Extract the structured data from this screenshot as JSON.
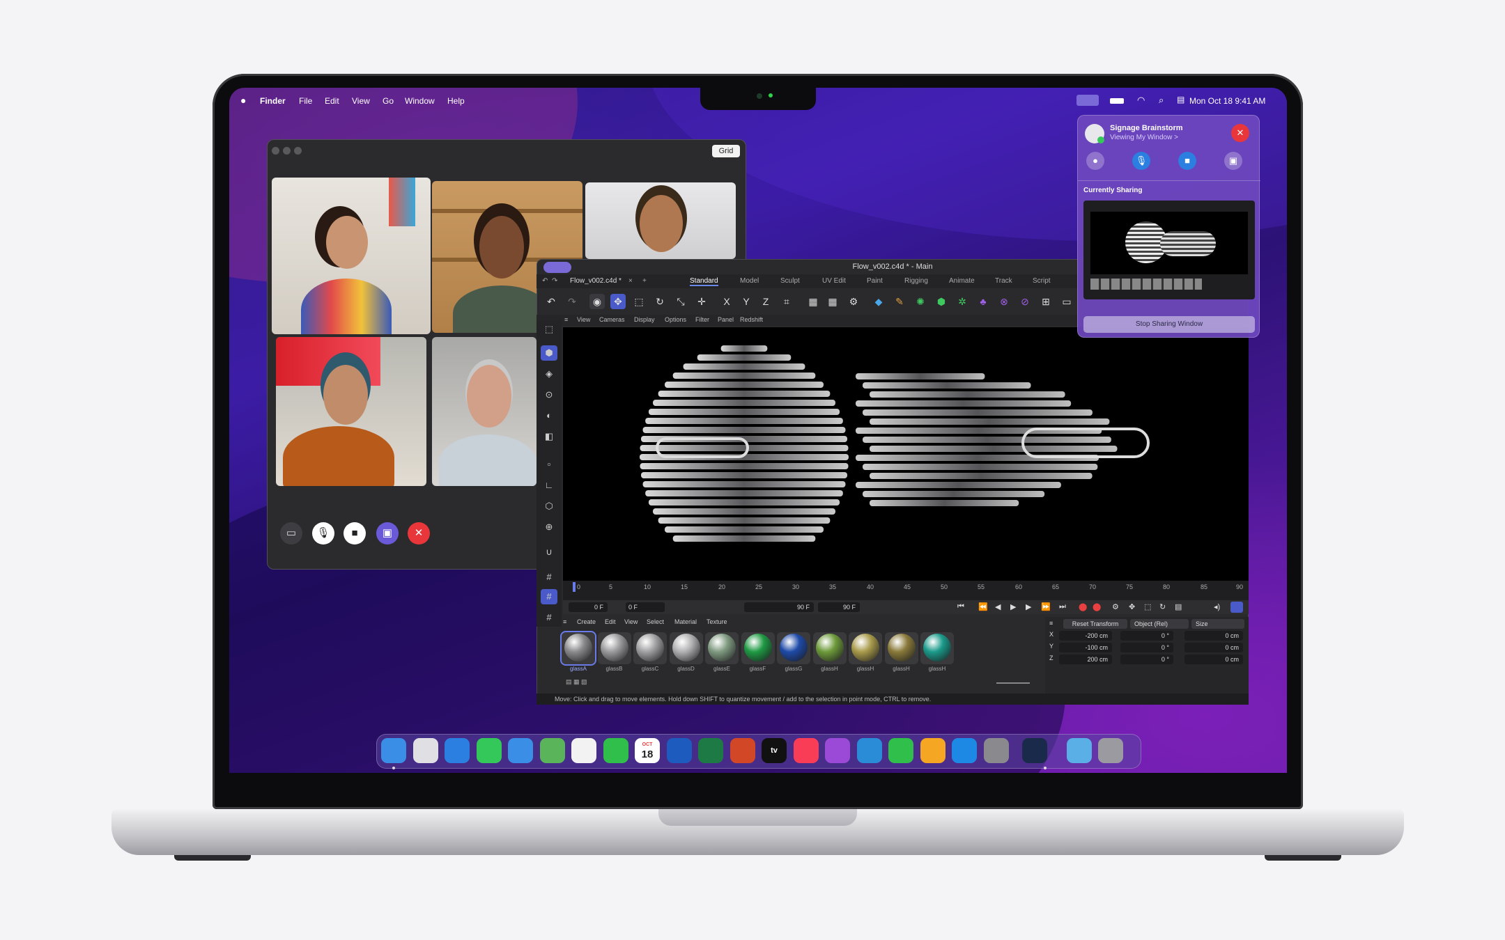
{
  "menubar": {
    "apple_icon": "apple-logo-icon",
    "app_name": "Finder",
    "items": [
      "File",
      "Edit",
      "View",
      "Go",
      "Window",
      "Help"
    ],
    "datetime": "Mon Oct 18  9:41 AM"
  },
  "facetime": {
    "grid_label": "Grid",
    "participants": [
      "participant-1",
      "participant-2",
      "participant-3",
      "participant-4",
      "participant-5"
    ]
  },
  "cinema4d": {
    "title": "Flow_v002.c4d * - Main",
    "file_tab": "Flow_v002.c4d *",
    "layouts": [
      "Standard",
      "Model",
      "Sculpt",
      "UV Edit",
      "Paint",
      "Rigging",
      "Animate",
      "Track",
      "Script"
    ],
    "viewport_menu": [
      "View",
      "Cameras",
      "Display",
      "Options",
      "Filter",
      "Panel",
      "Redshift"
    ],
    "timeline_ticks": [
      "0",
      "5",
      "10",
      "15",
      "20",
      "25",
      "30",
      "35",
      "40",
      "45",
      "50",
      "55",
      "60",
      "65",
      "70",
      "75",
      "80",
      "85",
      "90"
    ],
    "frame_fields": [
      "0 F",
      "0 F",
      "90 F",
      "90 F"
    ],
    "material_menu": [
      "Create",
      "Edit",
      "View",
      "Select",
      "Material",
      "Texture"
    ],
    "materials": [
      {
        "name": "glassA",
        "color": "#8a8a8c"
      },
      {
        "name": "glassB",
        "color": "#9a9a9c"
      },
      {
        "name": "glassC",
        "color": "#a0a0a2"
      },
      {
        "name": "glassD",
        "color": "#b0b0b2"
      },
      {
        "name": "glassE",
        "color": "#7f9a80"
      },
      {
        "name": "glassF",
        "color": "#1f9a44"
      },
      {
        "name": "glassG",
        "color": "#1e4aa8"
      },
      {
        "name": "glassH",
        "color": "#6d9a3a"
      },
      {
        "name": "glassH",
        "color": "#a89a4a"
      },
      {
        "name": "glassH",
        "color": "#8a7a3a"
      },
      {
        "name": "glassH",
        "color": "#1a9a8a"
      }
    ],
    "coord_buttons": [
      "Reset Transform",
      "Object (Rel)",
      "Size"
    ],
    "coord_rows": [
      {
        "axis": "X",
        "pos": "-200 cm",
        "rot": "0 °",
        "size": "0 cm"
      },
      {
        "axis": "Y",
        "pos": "-100 cm",
        "rot": "0 °",
        "size": "0 cm"
      },
      {
        "axis": "Z",
        "pos": "200 cm",
        "rot": "0 °",
        "size": "0 cm"
      }
    ],
    "status": "Move: Click and drag to move elements. Hold down SHIFT to quantize movement / add to the selection in point mode, CTRL to remove."
  },
  "shareplay": {
    "session_title": "Signage Brainstorm",
    "session_subtitle": "Viewing My Window >",
    "currently_sharing": "Currently Sharing",
    "stop_button": "Stop Sharing Window"
  },
  "dock": {
    "apps": [
      {
        "name": "finder-icon",
        "color": "#3a8ee6"
      },
      {
        "name": "launchpad-icon",
        "color": "#e0e0e4"
      },
      {
        "name": "safari-icon",
        "color": "#2a7fe0"
      },
      {
        "name": "messages-icon",
        "color": "#34c759"
      },
      {
        "name": "mail-icon",
        "color": "#3a8ee6"
      },
      {
        "name": "maps-icon",
        "color": "#5ab55a"
      },
      {
        "name": "photos-icon",
        "color": "#f2f2f2"
      },
      {
        "name": "facetime-icon",
        "color": "#2fbf4a"
      },
      {
        "name": "calendar-icon",
        "color": "#ffffff"
      },
      {
        "name": "word-icon",
        "color": "#1e5bbf"
      },
      {
        "name": "excel-icon",
        "color": "#1d7a44"
      },
      {
        "name": "powerpoint-icon",
        "color": "#d24726"
      },
      {
        "name": "appletv-icon",
        "color": "#111111"
      },
      {
        "name": "music-icon",
        "color": "#fa3d56"
      },
      {
        "name": "podcasts-icon",
        "color": "#9a4ad6"
      },
      {
        "name": "keynote-icon",
        "color": "#2a8bd6"
      },
      {
        "name": "numbers-icon",
        "color": "#2fbf4a"
      },
      {
        "name": "pages-icon",
        "color": "#f5a623"
      },
      {
        "name": "appstore-icon",
        "color": "#1e88e5"
      },
      {
        "name": "system-preferences-icon",
        "color": "#8a8a8e"
      },
      {
        "name": "cinema4d-icon",
        "color": "#1a2a4a"
      },
      {
        "name": "downloads-folder-icon",
        "color": "#5ab0e6"
      },
      {
        "name": "trash-icon",
        "color": "#9a9aa0"
      }
    ],
    "calendar_month": "OCT",
    "calendar_day": "18",
    "appletv_label": "tv"
  }
}
